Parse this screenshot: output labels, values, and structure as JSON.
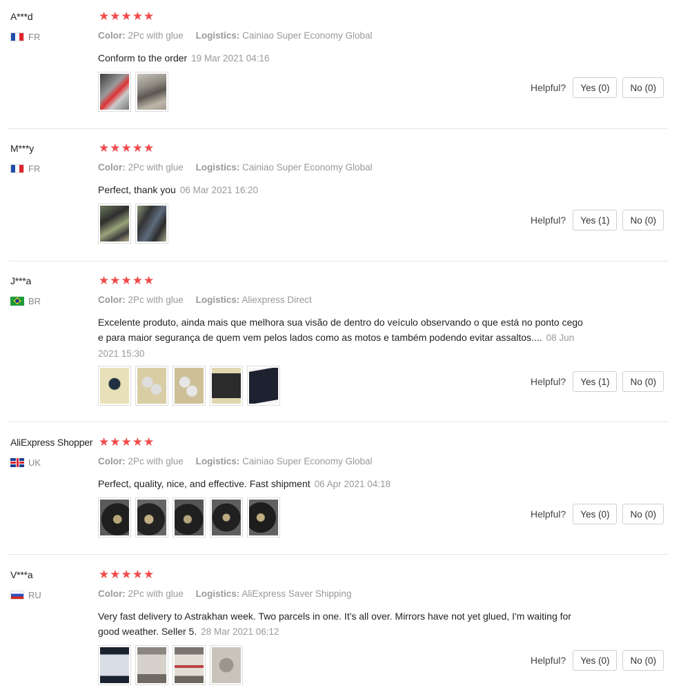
{
  "labels": {
    "color": "Color:",
    "logistics": "Logistics:",
    "helpful": "Helpful?"
  },
  "star_color": "#f04a4a",
  "reviews": [
    {
      "user": "A***d",
      "country": "FR",
      "stars": "★★★★★",
      "color_value": "2Pc with glue",
      "logistics_value": "Cainiao Super Economy Global",
      "text": "Conform to the order",
      "date": "19 Mar 2021 04:16",
      "thumbs": 2,
      "yes": "Yes (0)",
      "no": "No (0)"
    },
    {
      "user": "M***y",
      "country": "FR",
      "stars": "★★★★★",
      "color_value": "2Pc with glue",
      "logistics_value": "Cainiao Super Economy Global",
      "text": "Perfect, thank you",
      "date": "06 Mar 2021 16:20",
      "thumbs": 2,
      "yes": "Yes (1)",
      "no": "No (0)"
    },
    {
      "user": "J***a",
      "country": "BR",
      "stars": "★★★★★",
      "color_value": "2Pc with glue",
      "logistics_value": "Aliexpress Direct",
      "text": "Excelente produto, ainda mais que melhora sua visão de dentro do veículo observando o que está no ponto cego e para maior segurança de quem vem pelos lados como as motos e também podendo evitar assaltos....",
      "date": "08 Jun 2021 15:30",
      "thumbs": 5,
      "yes": "Yes (1)",
      "no": "No (0)"
    },
    {
      "user": "AliExpress Shopper",
      "country": "UK",
      "stars": "★★★★★",
      "color_value": "2Pc with glue",
      "logistics_value": "Cainiao Super Economy Global",
      "text": "Perfect, quality, nice, and effective. Fast shipment",
      "date": "06 Apr 2021 04:18",
      "thumbs": 5,
      "yes": "Yes (0)",
      "no": "No (0)"
    },
    {
      "user": "V***a",
      "country": "RU",
      "stars": "★★★★★",
      "color_value": "2Pc with glue",
      "logistics_value": "AliExpress Saver Shipping",
      "text": "Very fast delivery to Astrakhan week. Two parcels in one. It's all over. Mirrors have not yet glued, I'm waiting for good weather. Seller 5.",
      "date": "28 Mar 2021 06:12",
      "thumbs": 4,
      "yes": "Yes (0)",
      "no": "No (0)"
    }
  ]
}
